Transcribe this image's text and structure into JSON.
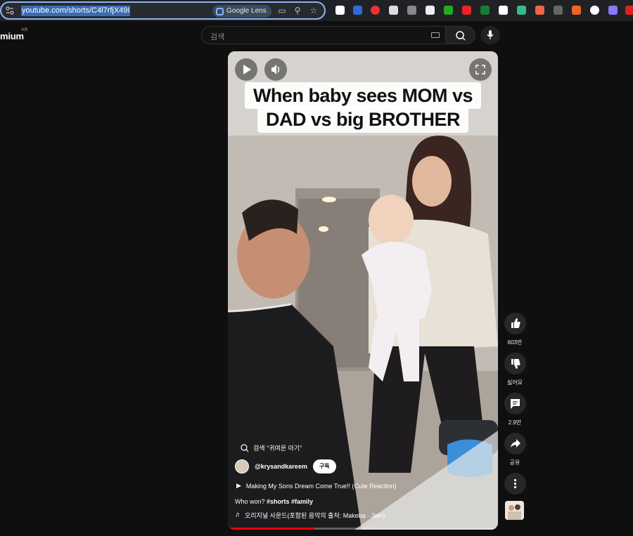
{
  "browser": {
    "url": "youtube.com/shorts/C4l7rfjX49I",
    "lens_label": "Google Lens",
    "extensions": [
      "n-icon",
      "folder-icon",
      "play-red-icon",
      "puzzle-icon",
      "camera-icon",
      "tv-icon",
      "green-doc-icon",
      "green-play-icon",
      "chart-icon",
      "shield-icon",
      "mail-icon",
      "fox-icon",
      "bar-icon",
      "fox-icon-2",
      "chat-icon",
      "purple-icon",
      "red-s-icon"
    ]
  },
  "header": {
    "logo": "mium",
    "region": "KR",
    "search_placeholder": "검색"
  },
  "video": {
    "caption_line1": "When baby sees MOM vs",
    "caption_line2": "DAD vs big BROTHER",
    "search_chip": "검색 \"귀여운 아기\"",
    "channel": "@krysandkareem",
    "subscribe": "구독",
    "playlist": "Making My Sons Dream Come True!! (Cute Reaction)",
    "desc_text": "Who won? ",
    "desc_tags": "#shorts #family",
    "music": "오리지널 사운드(포함된 음악의 출처: Makeba · Jain)",
    "progress": 0.32
  },
  "actions": {
    "like_count": "603만",
    "dislike_label": "싫어요",
    "comment_count": "2.9만",
    "share_label": "공유"
  },
  "colors": {
    "accent": "#ff0000",
    "omnibox_focus": "#8ab4f8"
  }
}
